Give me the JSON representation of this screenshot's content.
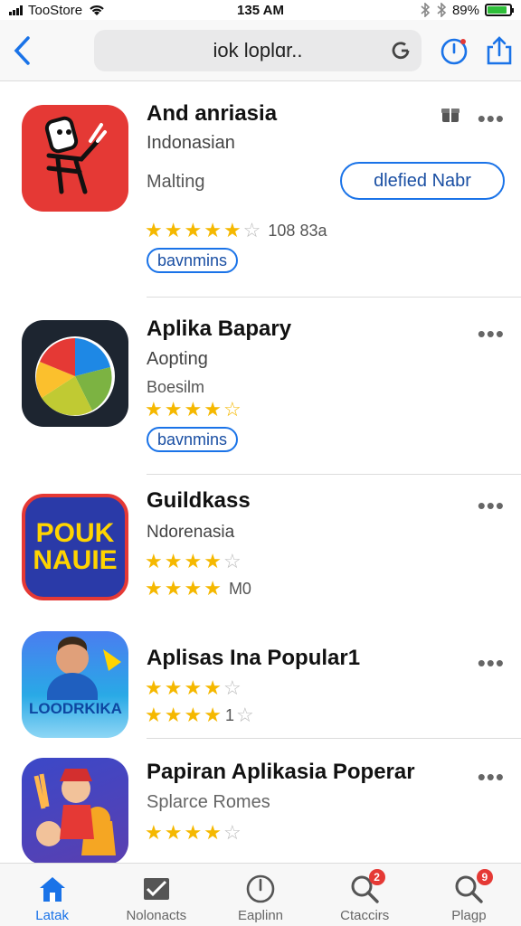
{
  "status_bar": {
    "carrier": "TooStore",
    "time": "135 AM",
    "battery": "89%",
    "battery_level": 0.89
  },
  "nav": {
    "address": "iok loplɑr..",
    "back_icon": "chevron-left-icon",
    "reload_icon": "reload-icon",
    "action_icons": [
      "timer-icon",
      "share-icon"
    ]
  },
  "apps": [
    {
      "name": "And anriasia",
      "developer": "Indonasian",
      "category": "Malting",
      "get_label": "dlefied Nabr",
      "rating": 4.5,
      "rating_count": "108 83a",
      "pill": "bavnmins",
      "more": "•••",
      "icon_color": "#e53935"
    },
    {
      "name": "Aplika Bapary",
      "developer": "Aopting",
      "category": "Boesilm",
      "rating": 4,
      "pill": "bavnmins",
      "more": "•••",
      "icon_color": "#1d2530"
    },
    {
      "name": "Guildkass",
      "developer": "Ndorenasia",
      "rating": 4,
      "rating2": 4,
      "rating_count2": "M0",
      "more": "•••",
      "icon_text_line1": "POUK",
      "icon_text_line2": "NAUIE",
      "icon_color": "#2a3aa8"
    },
    {
      "name": "Aplisas Ina Popular1",
      "rating": 4,
      "rating2": 4,
      "rating_count2": "1",
      "more": "•••",
      "icon_text": "LOODRKIKA",
      "icon_color": "#29a9e6"
    },
    {
      "name": "Papiran Aplikasia Poperar",
      "developer": "Splarce Romes",
      "rating": 4,
      "more": "•••",
      "icon_color": "#3b48c8"
    }
  ],
  "tabs": [
    {
      "label": "Latak",
      "icon": "home-icon",
      "active": true
    },
    {
      "label": "Nolonacts",
      "icon": "inbox-icon"
    },
    {
      "label": "Eaplinn",
      "icon": "clock-icon"
    },
    {
      "label": "Ctaccirs",
      "icon": "search-icon",
      "badge": "2"
    },
    {
      "label": "Plagp",
      "icon": "search-icon",
      "badge": "9"
    }
  ]
}
